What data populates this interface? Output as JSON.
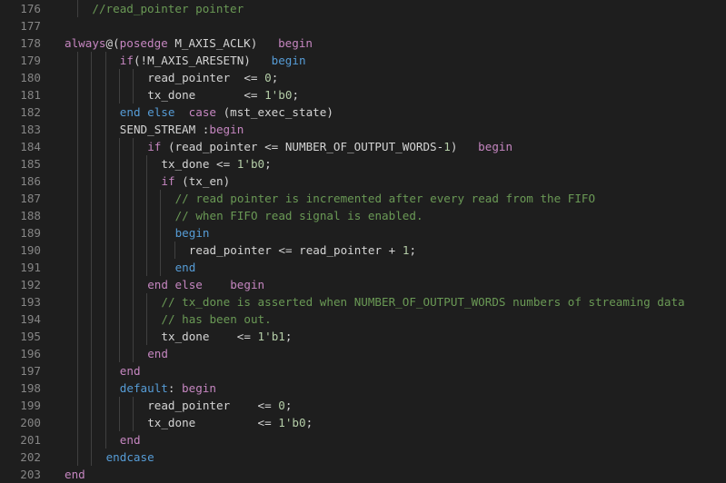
{
  "editor": {
    "colors": {
      "background": "#1e1e1e",
      "line_number": "#858585",
      "text": "#d4d4d4",
      "comment": "#6a9955",
      "keyword": "#569cd6",
      "control": "#c586c0",
      "number": "#b5cea8",
      "indent_guide": "#404040"
    },
    "lines": [
      {
        "num": "176",
        "indent": 4,
        "tokens": [
          {
            "t": "//read_pointer pointer",
            "c": "comment"
          }
        ]
      },
      {
        "num": "177",
        "indent": 0,
        "tokens": []
      },
      {
        "num": "178",
        "indent": 0,
        "tokens": [
          {
            "t": "always",
            "c": "ctrl"
          },
          {
            "t": "@(",
            "c": "op"
          },
          {
            "t": "posedge",
            "c": "ctrl"
          },
          {
            "t": " M_AXIS_ACLK)   ",
            "c": "ident"
          },
          {
            "t": "begin",
            "c": "ctrl"
          }
        ]
      },
      {
        "num": "179",
        "indent": 8,
        "tokens": [
          {
            "t": "if",
            "c": "ctrl"
          },
          {
            "t": "(!M_AXIS_ARESETN)   ",
            "c": "ident"
          },
          {
            "t": "begin",
            "c": "kw"
          }
        ]
      },
      {
        "num": "180",
        "indent": 12,
        "tokens": [
          {
            "t": "read_pointer  <= ",
            "c": "ident"
          },
          {
            "t": "0",
            "c": "num"
          },
          {
            "t": ";",
            "c": "op"
          }
        ]
      },
      {
        "num": "181",
        "indent": 12,
        "tokens": [
          {
            "t": "tx_done       <= ",
            "c": "ident"
          },
          {
            "t": "1'b0",
            "c": "num"
          },
          {
            "t": ";",
            "c": "op"
          }
        ]
      },
      {
        "num": "182",
        "indent": 8,
        "tokens": [
          {
            "t": "end",
            "c": "kw"
          },
          {
            "t": " ",
            "c": "op"
          },
          {
            "t": "else",
            "c": "kw"
          },
          {
            "t": "  ",
            "c": "op"
          },
          {
            "t": "case",
            "c": "ctrl"
          },
          {
            "t": " (mst_exec_state)",
            "c": "ident"
          }
        ]
      },
      {
        "num": "183",
        "indent": 8,
        "tokens": [
          {
            "t": "SEND_STREAM :",
            "c": "ident"
          },
          {
            "t": "begin",
            "c": "ctrl"
          }
        ]
      },
      {
        "num": "184",
        "indent": 12,
        "tokens": [
          {
            "t": "if",
            "c": "ctrl"
          },
          {
            "t": " (read_pointer <= NUMBER_OF_OUTPUT_WORDS-",
            "c": "ident"
          },
          {
            "t": "1",
            "c": "num"
          },
          {
            "t": ")   ",
            "c": "ident"
          },
          {
            "t": "begin",
            "c": "ctrl"
          }
        ]
      },
      {
        "num": "185",
        "indent": 14,
        "tokens": [
          {
            "t": "tx_done <= ",
            "c": "ident"
          },
          {
            "t": "1'b0",
            "c": "num"
          },
          {
            "t": ";",
            "c": "op"
          }
        ]
      },
      {
        "num": "186",
        "indent": 14,
        "tokens": [
          {
            "t": "if",
            "c": "ctrl"
          },
          {
            "t": " (tx_en)",
            "c": "ident"
          }
        ]
      },
      {
        "num": "187",
        "indent": 16,
        "tokens": [
          {
            "t": "// read pointer is incremented after every read from the FIFO",
            "c": "comment"
          }
        ]
      },
      {
        "num": "188",
        "indent": 16,
        "tokens": [
          {
            "t": "// when FIFO read signal is enabled.",
            "c": "comment"
          }
        ]
      },
      {
        "num": "189",
        "indent": 16,
        "tokens": [
          {
            "t": "begin",
            "c": "kw"
          }
        ]
      },
      {
        "num": "190",
        "indent": 18,
        "tokens": [
          {
            "t": "read_pointer <= read_pointer + ",
            "c": "ident"
          },
          {
            "t": "1",
            "c": "num"
          },
          {
            "t": ";",
            "c": "op"
          }
        ]
      },
      {
        "num": "191",
        "indent": 16,
        "tokens": [
          {
            "t": "end",
            "c": "kw"
          }
        ]
      },
      {
        "num": "192",
        "indent": 12,
        "tokens": [
          {
            "t": "end",
            "c": "ctrl"
          },
          {
            "t": " ",
            "c": "op"
          },
          {
            "t": "else",
            "c": "ctrl"
          },
          {
            "t": "    ",
            "c": "op"
          },
          {
            "t": "begin",
            "c": "ctrl"
          }
        ]
      },
      {
        "num": "193",
        "indent": 14,
        "tokens": [
          {
            "t": "// tx_done is asserted when NUMBER_OF_OUTPUT_WORDS numbers of streaming data",
            "c": "comment"
          }
        ]
      },
      {
        "num": "194",
        "indent": 14,
        "tokens": [
          {
            "t": "// has been out.",
            "c": "comment"
          }
        ]
      },
      {
        "num": "195",
        "indent": 14,
        "tokens": [
          {
            "t": "tx_done    <= ",
            "c": "ident"
          },
          {
            "t": "1'b1",
            "c": "num"
          },
          {
            "t": ";",
            "c": "op"
          }
        ]
      },
      {
        "num": "196",
        "indent": 12,
        "tokens": [
          {
            "t": "end",
            "c": "ctrl"
          }
        ]
      },
      {
        "num": "197",
        "indent": 8,
        "tokens": [
          {
            "t": "end",
            "c": "ctrl"
          }
        ]
      },
      {
        "num": "198",
        "indent": 8,
        "tokens": [
          {
            "t": "default",
            "c": "kw"
          },
          {
            "t": ": ",
            "c": "op"
          },
          {
            "t": "begin",
            "c": "ctrl"
          }
        ]
      },
      {
        "num": "199",
        "indent": 12,
        "tokens": [
          {
            "t": "read_pointer    <= ",
            "c": "ident"
          },
          {
            "t": "0",
            "c": "num"
          },
          {
            "t": ";",
            "c": "op"
          }
        ]
      },
      {
        "num": "200",
        "indent": 12,
        "tokens": [
          {
            "t": "tx_done         <= ",
            "c": "ident"
          },
          {
            "t": "1'b0",
            "c": "num"
          },
          {
            "t": ";",
            "c": "op"
          }
        ]
      },
      {
        "num": "201",
        "indent": 8,
        "tokens": [
          {
            "t": "end",
            "c": "ctrl"
          }
        ]
      },
      {
        "num": "202",
        "indent": 6,
        "tokens": [
          {
            "t": "endcase",
            "c": "kw"
          }
        ]
      },
      {
        "num": "203",
        "indent": 0,
        "tokens": [
          {
            "t": "end",
            "c": "ctrl"
          }
        ]
      }
    ]
  }
}
